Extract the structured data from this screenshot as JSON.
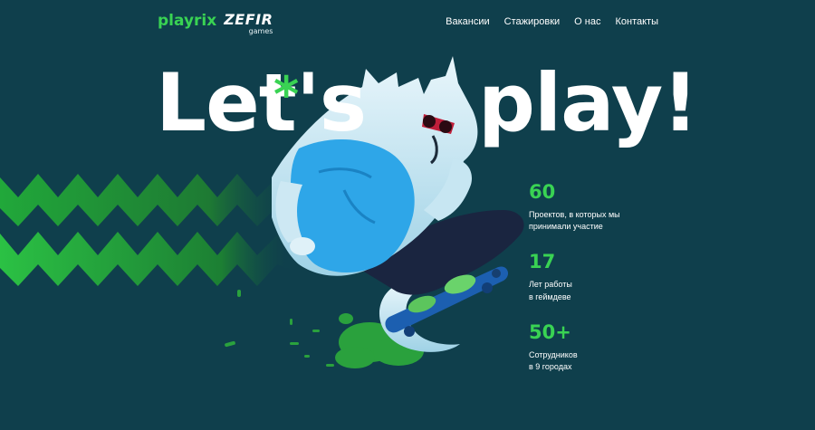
{
  "header": {
    "logo_primary": "playrix",
    "logo_secondary": "ZEFIR",
    "logo_secondary_sub": "games",
    "nav": [
      {
        "label": "Вакансии"
      },
      {
        "label": "Стажировки"
      },
      {
        "label": "О нас"
      },
      {
        "label": "Контакты"
      }
    ]
  },
  "hero": {
    "headline_left": "Let's",
    "headline_right": "play!",
    "asterisk": "*",
    "illustration": "wolf-on-skateboard"
  },
  "stats": [
    {
      "number": "60",
      "text": "Проектов, в которых мы\nпринимали участие"
    },
    {
      "number": "17",
      "text": "Лет работы\nв геймдеве"
    },
    {
      "number": "50+",
      "text": "Сотрудников\nв 9 городах"
    }
  ],
  "colors": {
    "background": "#0f3f4c",
    "accent_green": "#39d353",
    "wolf_blue": "#2ea6e8",
    "text": "#ffffff"
  }
}
